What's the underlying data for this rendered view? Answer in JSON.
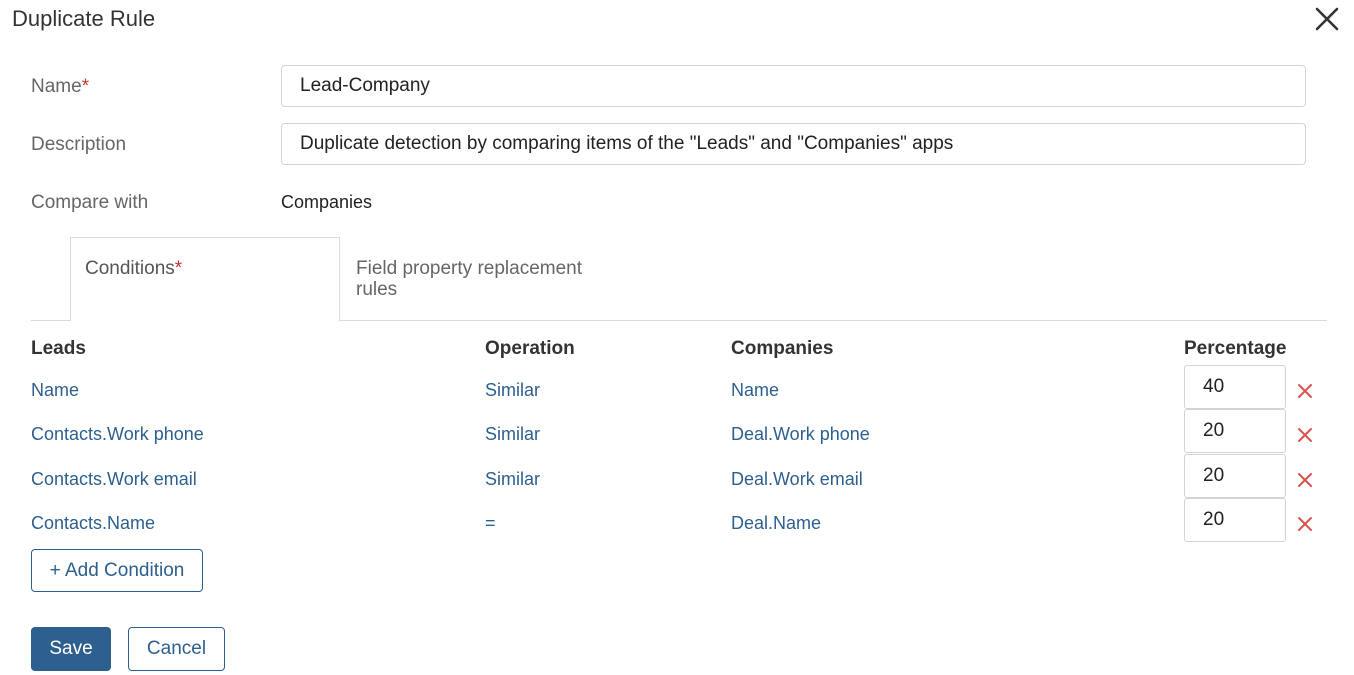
{
  "dialog": {
    "title": "Duplicate Rule"
  },
  "form": {
    "name_label": "Name",
    "required_mark": "*",
    "name_value": "Lead-Company",
    "description_label": "Description",
    "description_value": "Duplicate detection by comparing items of the \"Leads\" and \"Companies\" apps",
    "compare_label": "Compare with",
    "compare_value": "Companies"
  },
  "tabs": {
    "conditions": "Conditions",
    "replacement": "Field property replacement rules"
  },
  "table": {
    "headers": [
      "Leads",
      "Operation",
      "Companies",
      "Percentage"
    ],
    "rows": [
      {
        "lead": "Name",
        "operation": "Similar",
        "company": "Name",
        "percentage": "40"
      },
      {
        "lead": "Contacts.Work phone",
        "operation": "Similar",
        "company": "Deal.Work phone",
        "percentage": "20"
      },
      {
        "lead": "Contacts.Work email",
        "operation": "Similar",
        "company": "Deal.Work email",
        "percentage": "20"
      },
      {
        "lead": "Contacts.Name",
        "operation": "=",
        "company": "Deal.Name",
        "percentage": "20"
      }
    ]
  },
  "actions": {
    "add_condition": "+ Add Condition",
    "save": "Save",
    "cancel": "Cancel"
  },
  "colors": {
    "accent": "#2d5f8f",
    "delete": "#d9534f",
    "required": "#c0392b"
  },
  "icons": {
    "close": "close-icon",
    "delete": "delete-icon"
  }
}
